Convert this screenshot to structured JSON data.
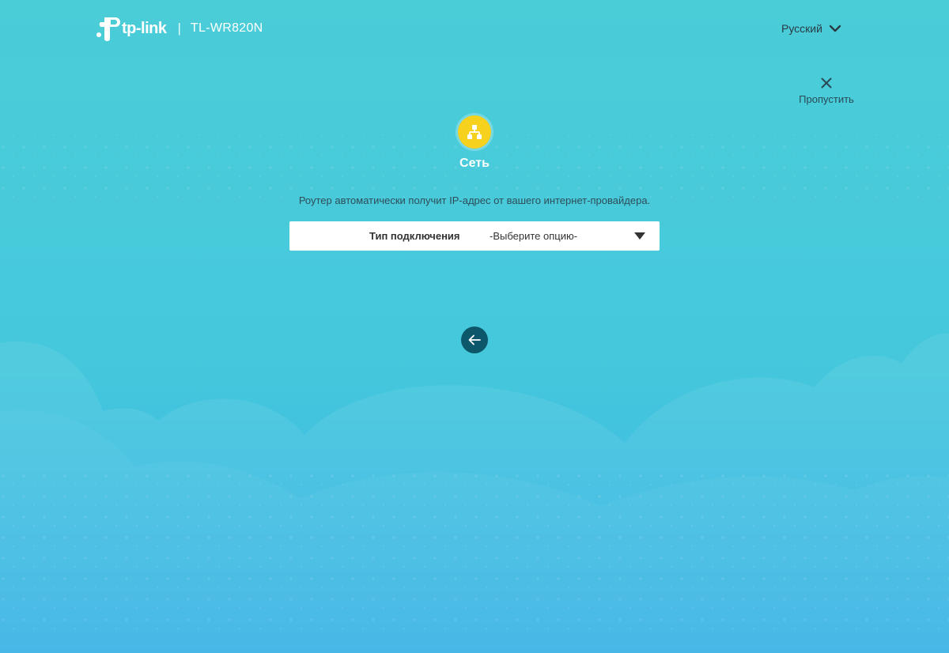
{
  "header": {
    "brand": "tp-link",
    "separator": "|",
    "model": "TL-WR820N",
    "language": "Русский"
  },
  "skip": {
    "label": "Пропустить",
    "icon": "close-icon"
  },
  "step": {
    "icon": "network-icon",
    "title": "Сеть"
  },
  "description": "Роутер автоматически получит IP-адрес от вашего интернет-провайдера.",
  "connection": {
    "label": "Тип подключения",
    "value": "-Выберите опцию-"
  },
  "navigation": {
    "back_icon": "arrow-left-icon"
  },
  "colors": {
    "background_top": "#4bcdd8",
    "background_bottom": "#33b0e6",
    "step_badge": "#f6d11d",
    "back_button": "#0c5769"
  }
}
